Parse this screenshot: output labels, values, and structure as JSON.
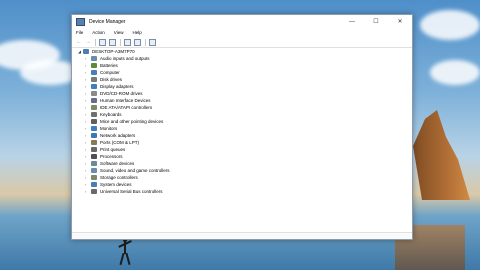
{
  "window": {
    "title": "Device Manager",
    "controls": {
      "minimize": "—",
      "maximize": "☐",
      "close": "✕"
    }
  },
  "menu": [
    "File",
    "Action",
    "View",
    "Help"
  ],
  "toolbar": {
    "back_icon": "back-arrow-icon",
    "forward_icon": "forward-arrow-icon"
  },
  "tree": {
    "root": "DESKTOP-A3M7P70",
    "items": [
      {
        "label": "Audio inputs and outputs",
        "icon": "speaker-icon",
        "color": "#6a8caf"
      },
      {
        "label": "Batteries",
        "icon": "battery-icon",
        "color": "#5a8a3a"
      },
      {
        "label": "Computer",
        "icon": "computer-icon",
        "color": "#4a7fb5"
      },
      {
        "label": "Disk drives",
        "icon": "disk-icon",
        "color": "#7a7a7a"
      },
      {
        "label": "Display adapters",
        "icon": "monitor-icon",
        "color": "#3f7ebf"
      },
      {
        "label": "DVD/CD-ROM drives",
        "icon": "dvd-icon",
        "color": "#8a8a8a"
      },
      {
        "label": "Human Interface Devices",
        "icon": "hid-icon",
        "color": "#6a6a8a"
      },
      {
        "label": "IDE ATA/ATAPI controllers",
        "icon": "ide-icon",
        "color": "#7a8a6a"
      },
      {
        "label": "Keyboards",
        "icon": "keyboard-icon",
        "color": "#707070"
      },
      {
        "label": "Mice and other pointing devices",
        "icon": "mouse-icon",
        "color": "#606060"
      },
      {
        "label": "Monitors",
        "icon": "monitor-icon",
        "color": "#3f7ebf"
      },
      {
        "label": "Network adapters",
        "icon": "network-icon",
        "color": "#3d78b2"
      },
      {
        "label": "Ports (COM & LPT)",
        "icon": "port-icon",
        "color": "#8a7a5a"
      },
      {
        "label": "Print queues",
        "icon": "printer-icon",
        "color": "#6a6a6a"
      },
      {
        "label": "Processors",
        "icon": "processor-icon",
        "color": "#505050"
      },
      {
        "label": "Software devices",
        "icon": "software-device-icon",
        "color": "#6a8a9a"
      },
      {
        "label": "Sound, video and game controllers",
        "icon": "sound-icon",
        "color": "#6a8caf"
      },
      {
        "label": "Storage controllers",
        "icon": "storage-icon",
        "color": "#7a8a6a"
      },
      {
        "label": "System devices",
        "icon": "system-device-icon",
        "color": "#4a7fb5"
      },
      {
        "label": "Universal Serial Bus controllers",
        "icon": "usb-icon",
        "color": "#6a6a6a"
      }
    ]
  }
}
